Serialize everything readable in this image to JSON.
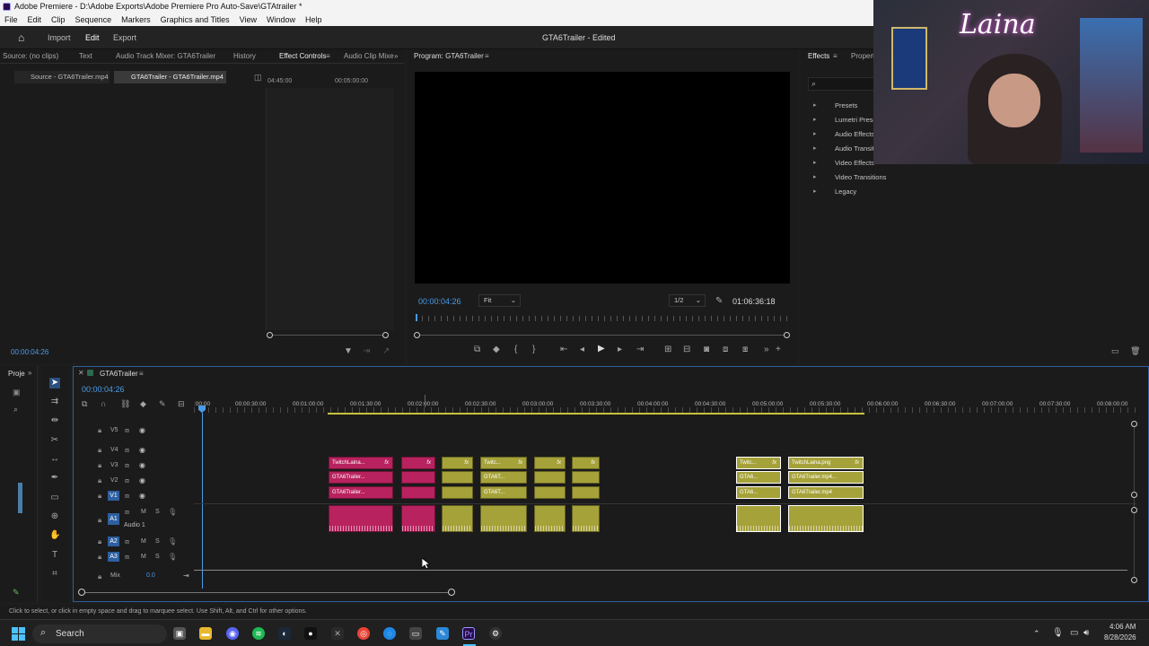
{
  "window": {
    "title": "Adobe Premiere - D:\\Adobe Exports\\Adobe Premiere Pro Auto-Save\\GTAtrailer *"
  },
  "menu": [
    "File",
    "Edit",
    "Clip",
    "Sequence",
    "Markers",
    "Graphics and Titles",
    "View",
    "Window",
    "Help"
  ],
  "workspace": {
    "import": "Import",
    "edit": "Edit",
    "export": "Export",
    "project_title": "GTA6Trailer - Edited"
  },
  "source_panel": {
    "tabs": [
      "Source: (no clips)",
      "Text",
      "Audio Track Mixer: GTA6Trailer",
      "History",
      "Effect Controls",
      "Audio Clip Mixe"
    ],
    "subtabs": [
      "Source - GTA6Trailer.mp4",
      "GTA6Trailer - GTA6Trailer.mp4"
    ],
    "time_left": "04:45:00",
    "time_right": "00:05:00:00",
    "timecode": "00:00:04:26"
  },
  "program": {
    "tab": "Program: GTA6Trailer",
    "timecode": "00:00:04:26",
    "fit": "Fit",
    "resolution": "1/2",
    "duration": "01:06:36:18"
  },
  "effects": {
    "tabs": [
      "Effects",
      "Propert"
    ],
    "items": [
      "Presets",
      "Lumetri Prese",
      "Audio Effects",
      "Audio Transit",
      "Video Effects",
      "Video Transitions",
      "Legacy"
    ]
  },
  "webcam": {
    "overlay_text": "Laina"
  },
  "project_panel": {
    "tab": "Proje"
  },
  "timeline": {
    "sequence": "GTA6Trailer",
    "timecode": "00:00:04:26",
    "ruler": [
      ":00:00",
      "00:00:30:00",
      "00:01:00:00",
      "00:01:30:00",
      "00:02:00:00",
      "00:02:30:00",
      "00:03:00:00",
      "00:03:30:00",
      "00:04:00:00",
      "00:04:30:00",
      "00:05:00:00",
      "00:05:30:00",
      "00:06:00:00",
      "00:06:30:00",
      "00:07:00:00",
      "00:07:30:00",
      "00:08:00:00"
    ],
    "tracks": {
      "v5": "V5",
      "v4": "V4",
      "v3": "V3",
      "v2": "V2",
      "v1": "V1",
      "a1": "A1",
      "audio1": "Audio 1",
      "a2": "A2",
      "a3": "A3",
      "mix": "Mix",
      "mix_val": "0.0",
      "m": "M",
      "s": "S"
    },
    "clips": {
      "c1v3": "TwitchLaina...",
      "c1v2": "GTA6Trailer...",
      "c1v1": "GTA6Trailer...",
      "c4v3": "Twitc...",
      "c4v2": "GTA6T...",
      "c4v1": "GTA6T...",
      "c7v3": "Twitc...",
      "c7v2": "GTA6...",
      "c7v1": "GTA6...",
      "c8v3": "TwitchLaina.png",
      "c8v2": "GTA6Trailer.mp4...",
      "c8v1": "GTA6Trailer.mp4",
      "fx": "fx"
    }
  },
  "status": {
    "hint": "Click to select, or click in empty space and drag to marquee select. Use Shift, Alt, and Ctrl for other options."
  },
  "taskbar": {
    "search": "Search",
    "time": "4:06 AM",
    "date": "8/28/2026"
  }
}
